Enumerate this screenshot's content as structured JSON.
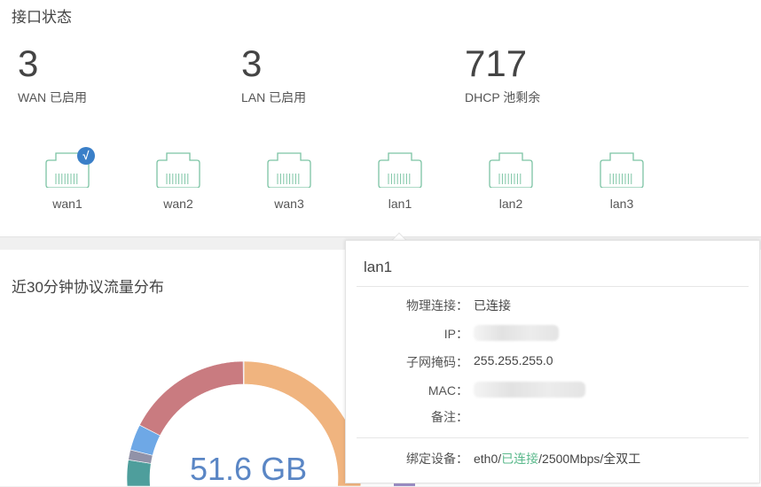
{
  "section_title": "接口状态",
  "stats": [
    {
      "value": "3",
      "label": "WAN 已启用"
    },
    {
      "value": "3",
      "label": "LAN 已启用"
    },
    {
      "value": "717",
      "label": "DHCP 池剩余"
    }
  ],
  "ports": [
    {
      "name": "wan1",
      "checked": true,
      "check_glyph": "√"
    },
    {
      "name": "wan2"
    },
    {
      "name": "wan3"
    },
    {
      "name": "lan1"
    },
    {
      "name": "lan2"
    },
    {
      "name": "lan3"
    }
  ],
  "port_color": "#7cc4a4",
  "traffic": {
    "title": "近30分钟协议流量分布",
    "total": "51.6 GB"
  },
  "chart_data": {
    "type": "pie",
    "title": "近30分钟协议流量分布",
    "center_label": "51.6 GB",
    "slices": [
      {
        "color": "#f0b47f",
        "value": 55
      },
      {
        "color": "#4e9e9c",
        "value": 22.5
      },
      {
        "color": "#9192a8",
        "value": 1.4
      },
      {
        "color": "#6ea8e6",
        "value": 3.6
      },
      {
        "color": "#c97b80",
        "value": 17.4
      },
      {
        "color": "#9d8fc6",
        "value": 0.1
      }
    ]
  },
  "tooltip": {
    "title": "lan1",
    "rows": [
      {
        "k": "物理连接：",
        "v": "已连接"
      },
      {
        "k": "IP：",
        "v": ""
      },
      {
        "k": "子网掩码：",
        "v": "255.255.255.0"
      },
      {
        "k": "MAC：",
        "v": ""
      },
      {
        "k": "备注：",
        "v": ""
      }
    ],
    "bind": {
      "k": "绑定设备：",
      "dev": "eth0/",
      "status": "已连接",
      "rest": "/2500Mbps/全双工"
    }
  }
}
